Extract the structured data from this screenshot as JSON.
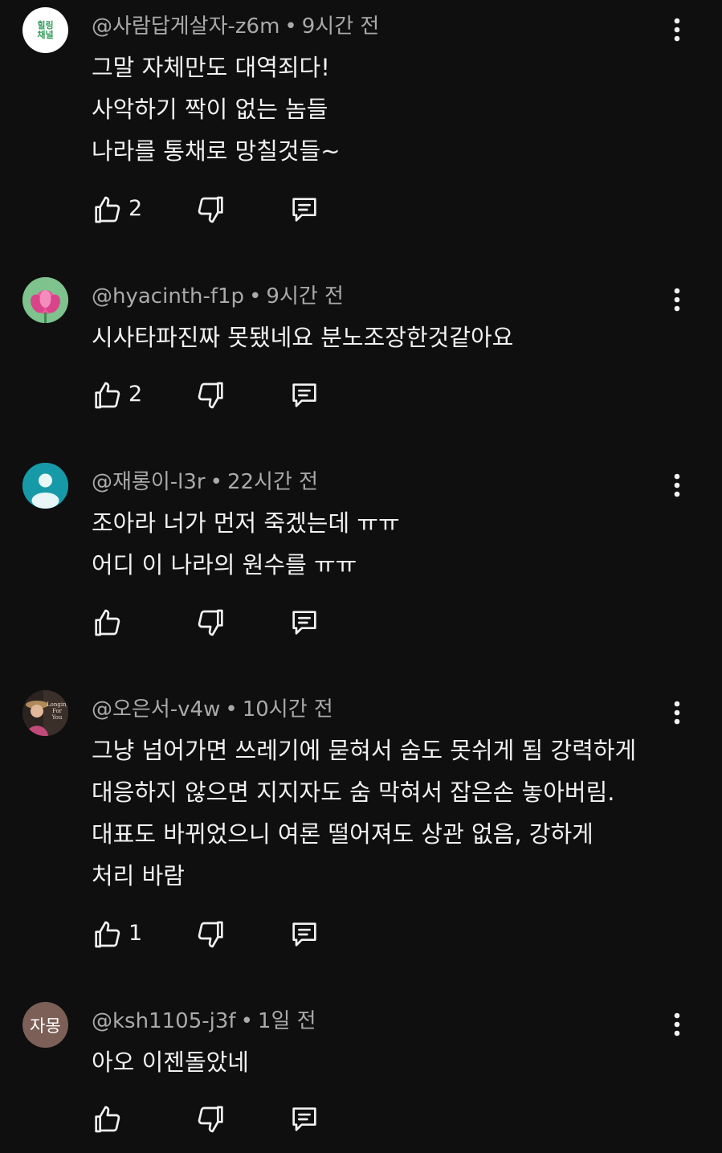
{
  "comments": [
    {
      "handle": "@사람답게살자-z6m",
      "time": "9시간 전",
      "lines": [
        "그말 자체만도 대역죄다!",
        "사악하기 짝이 없는 놈들",
        "나라를 통채로 망칠것들~"
      ],
      "likes": "2",
      "avatar": {
        "type": "text",
        "text": "힐링\n채널"
      }
    },
    {
      "handle": "@hyacinth-f1p",
      "time": "9시간 전",
      "lines": [
        "시사타파진짜 못됐네요 분노조장한것같아요"
      ],
      "likes": "2",
      "avatar": {
        "type": "lotus"
      }
    },
    {
      "handle": "@재롱이-l3r",
      "time": "22시간 전",
      "lines": [
        "조아라  너가 먼저 죽겠는데 ㅠㅠ",
        "어디 이  나라의 원수를 ㅠㅠ"
      ],
      "likes": "",
      "avatar": {
        "type": "person"
      }
    },
    {
      "handle": "@오은서-v4w",
      "time": "10시간 전",
      "lines": [
        "그냥 넘어가면 쓰레기에 묻혀서 숨도 못쉬게 됨 강력하게",
        "대응하지 않으면 지지자도 숨 막혀서 잡은손 놓아버림.",
        "대표도 바뀌었으니  여론 떨어져도 상관 없음, 강하게",
        "처리 바람"
      ],
      "likes": "1",
      "avatar": {
        "type": "photo",
        "text": "Longing For You"
      }
    },
    {
      "handle": "@ksh1105-j3f",
      "time": "1일 전",
      "lines": [
        "아오 이젠돌았네"
      ],
      "likes": "",
      "avatar": {
        "type": "text",
        "text": "자몽"
      }
    }
  ],
  "icons": {
    "like": "thumbs-up-icon",
    "dislike": "thumbs-down-icon",
    "reply": "reply-icon",
    "more": "more-vertical-icon"
  },
  "colors": {
    "background": "#0f0f0f",
    "text": "#f1f1f1",
    "meta": "#aaaaaa"
  }
}
